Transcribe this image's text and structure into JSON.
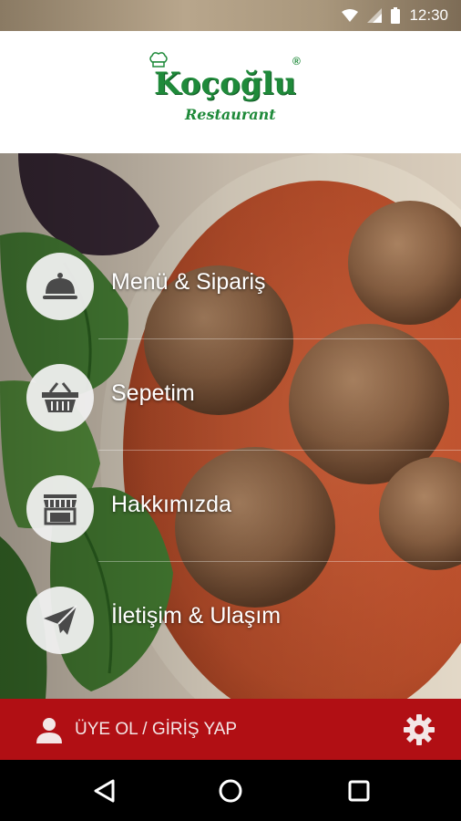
{
  "status_bar": {
    "time": "12:30",
    "icons": [
      "wifi-icon",
      "signal-icon",
      "battery-icon"
    ]
  },
  "header": {
    "logo_brand": "Koçoğlu",
    "logo_registered": "®",
    "logo_subtitle": "Restaurant",
    "logo_color": "#1f8a3a"
  },
  "menu": {
    "items": [
      {
        "label": "Menü & Sipariş",
        "icon": "cloche-icon"
      },
      {
        "label": "Sepetim",
        "icon": "basket-icon"
      },
      {
        "label": "Hakkımızda",
        "icon": "storefront-icon"
      },
      {
        "label": "İletişim & Ulaşım",
        "icon": "paper-plane-icon"
      }
    ]
  },
  "bottom_bar": {
    "login_label": "ÜYE OL / GİRİŞ YAP",
    "login_icon": "user-icon",
    "settings_icon": "gear-icon",
    "color": "#b10f14"
  },
  "nav_bar": {
    "buttons": [
      "back-icon",
      "home-icon",
      "recents-icon"
    ]
  }
}
